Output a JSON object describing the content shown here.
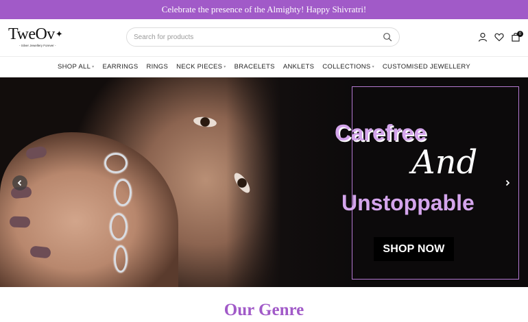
{
  "announcement": "Celebrate the presence of the Almighty! Happy Shivratri!",
  "logo": {
    "name": "TweOv",
    "tagline": "- Silver Jewellery Forever -"
  },
  "search": {
    "placeholder": "Search for products"
  },
  "cart": {
    "count": "0"
  },
  "nav": [
    {
      "label": "SHOP ALL",
      "dropdown": true
    },
    {
      "label": "EARRINGS",
      "dropdown": false
    },
    {
      "label": "RINGS",
      "dropdown": false
    },
    {
      "label": "NECK PIECES",
      "dropdown": true
    },
    {
      "label": "BRACELETS",
      "dropdown": false
    },
    {
      "label": "ANKLETS",
      "dropdown": false
    },
    {
      "label": "COLLECTIONS",
      "dropdown": true
    },
    {
      "label": "CUSTOMISED JEWELLERY",
      "dropdown": false
    }
  ],
  "hero": {
    "line1": "Carefree",
    "line2": "And",
    "line3": "Unstoppable",
    "cta": "SHOP NOW"
  },
  "section": {
    "title": "Our Genre"
  },
  "colors": {
    "brand": "#a15ac8",
    "hero_text": "#d4a5ec"
  },
  "icons": [
    "search-icon",
    "user-icon",
    "heart-icon",
    "bag-icon",
    "chevron-left-icon",
    "chevron-right-icon"
  ]
}
